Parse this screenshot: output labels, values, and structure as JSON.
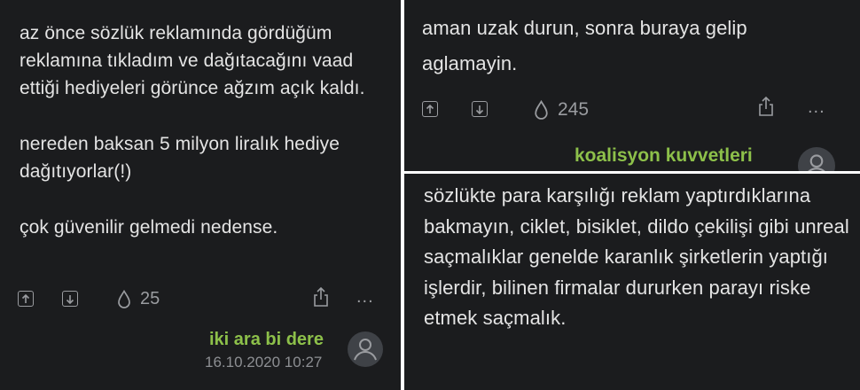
{
  "left": {
    "paragraphs": [
      "az önce sözlük reklamında gördüğüm reklamına tıkladım ve dağıtacağını vaad ettiği hediyeleri görünce ağzım açık kaldı.",
      "nereden baksan 5 milyon liralık hediye dağıtıyorlar(!)",
      "çok güvenilir gelmedi nedense."
    ],
    "favorite_count": "25",
    "author": "iki ara bi dere",
    "date": "16.10.2020 10:27",
    "more": "..."
  },
  "top_right": {
    "text": "aman uzak durun, sonra buraya gelip aglamayin.",
    "favorite_count": "245",
    "author": "koalisyon kuvvetleri",
    "more": "..."
  },
  "bottom_right": {
    "text": "sözlükte para karşılığı reklam yaptırdıklarına bakmayın, ciklet, bisiklet, dildo çekilişi gibi unreal saçmalıklar genelde karanlık şirketlerin yaptığı işlerdir, bilinen firmalar dururken parayı riske etmek saçmalık."
  },
  "colors": {
    "background": "#1b1c1e",
    "author": "#8dc04a",
    "icon": "#9a9ca0",
    "text": "#e4e4e4"
  },
  "icons": [
    "upvote-icon",
    "downvote-icon",
    "drop-icon",
    "share-icon",
    "more-icon",
    "avatar-icon"
  ]
}
